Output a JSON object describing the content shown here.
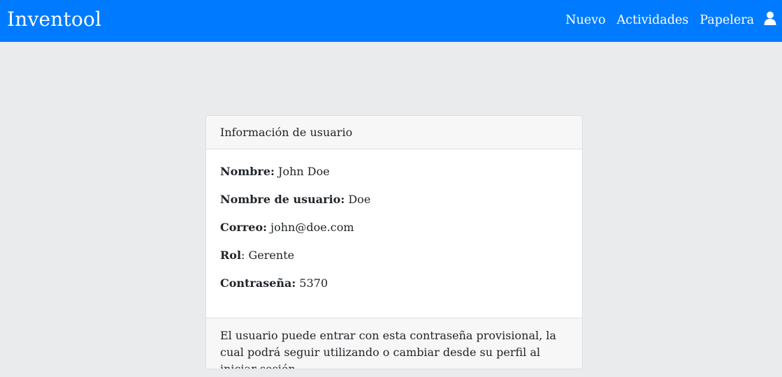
{
  "navbar": {
    "brand": "Inventool",
    "links": [
      "Nuevo",
      "Actividades",
      "Papelera"
    ],
    "user_icon": "user-icon",
    "accent_color": "#007bff"
  },
  "card": {
    "header": "Información de usuario",
    "fields": [
      {
        "label": "Nombre:",
        "value": " John Doe"
      },
      {
        "label": "Nombre de usuario:",
        "value": " Doe"
      },
      {
        "label": "Correo:",
        "value": " john@doe.com"
      },
      {
        "label": "Rol",
        "value": ": Gerente"
      },
      {
        "label": "Contraseña:",
        "value": " 5370"
      }
    ],
    "footer": "El usuario puede entrar con esta contraseña provisional, la cual podrá seguir utilizando o cambiar desde su perfil al iniciar sesión"
  }
}
